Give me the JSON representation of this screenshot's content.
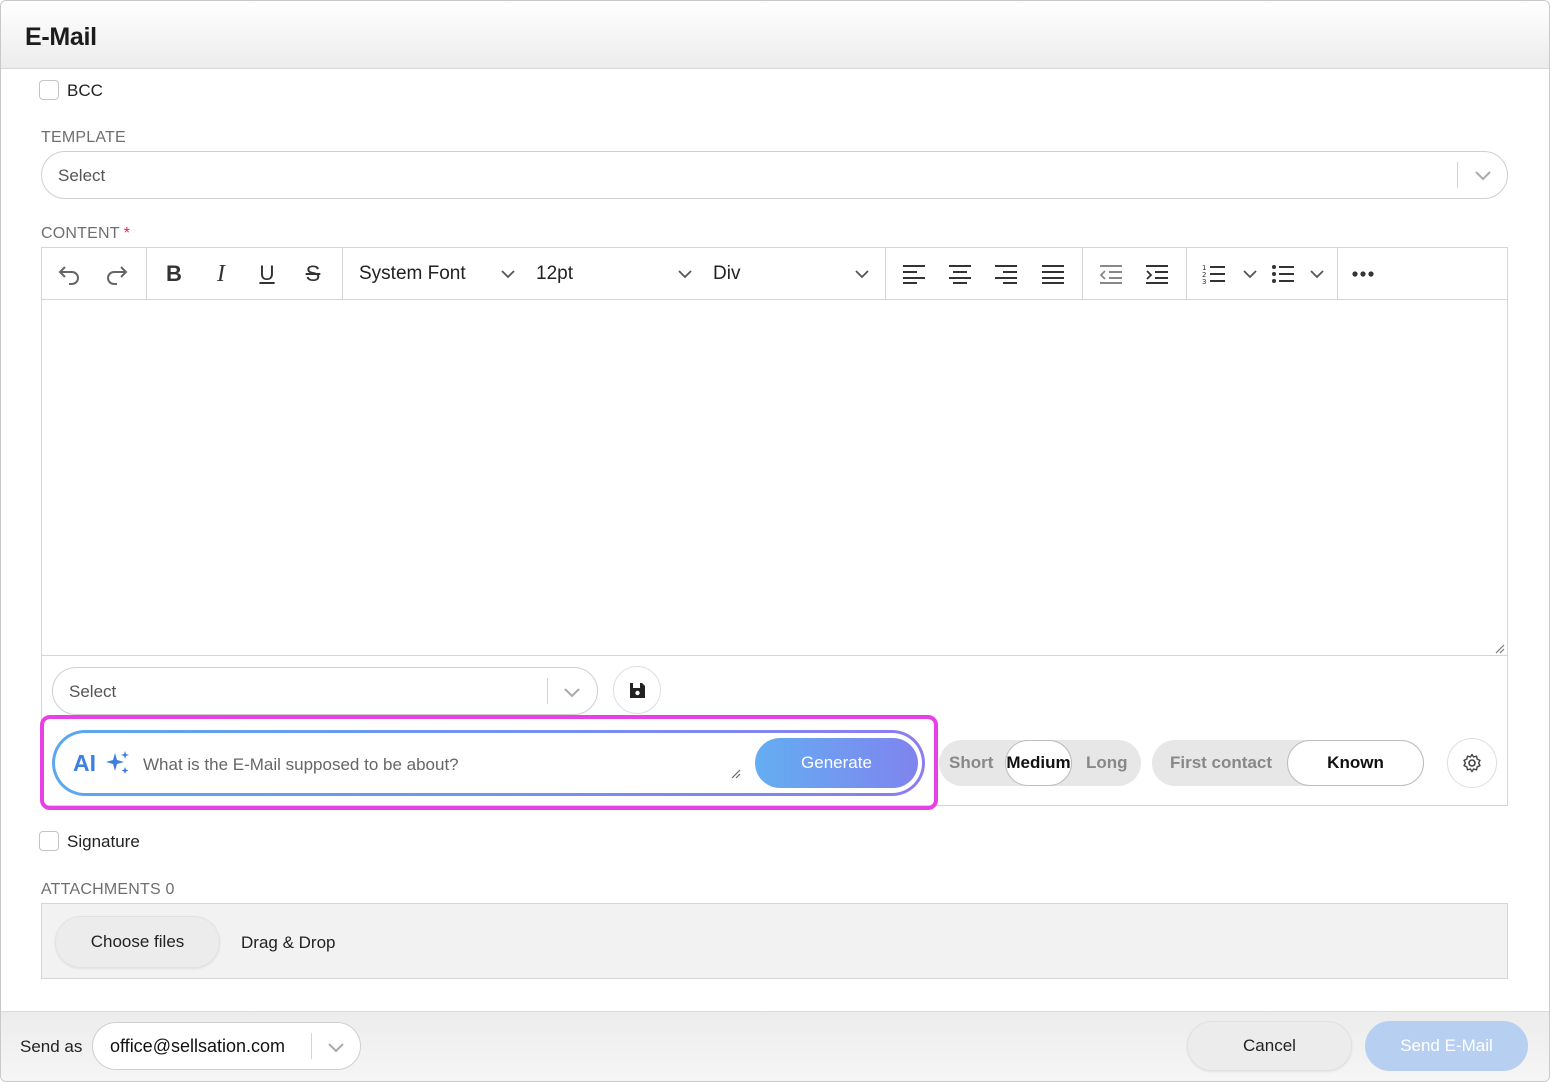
{
  "header": {
    "title": "E-Mail"
  },
  "bcc": {
    "label": "BCC",
    "checked": false
  },
  "template": {
    "label": "TEMPLATE",
    "value": "Select"
  },
  "content": {
    "label": "CONTENT",
    "required_mark": "*",
    "toolbar": {
      "font_family": "System Font",
      "font_size": "12pt",
      "block_format": "Div",
      "buttons": [
        "undo",
        "redo",
        "bold",
        "italic",
        "underline",
        "strikethrough",
        "align-left",
        "align-center",
        "align-right",
        "align-justify",
        "outdent",
        "indent",
        "numbered-list",
        "bullet-list",
        "more"
      ]
    },
    "body_text": ""
  },
  "snippet": {
    "value": "Select"
  },
  "ai": {
    "label": "AI",
    "placeholder": "What is the E-Mail supposed to be about?",
    "generate_label": "Generate",
    "length_options": [
      "Short",
      "Medium",
      "Long"
    ],
    "length_selected": "Medium",
    "relationship_options": [
      "First contact",
      "Known"
    ],
    "relationship_selected": "Known",
    "highlight_color": "#e640e6"
  },
  "signature": {
    "label": "Signature",
    "checked": false
  },
  "attachments": {
    "label": "ATTACHMENTS 0",
    "choose_label": "Choose files",
    "drop_label": "Drag & Drop"
  },
  "footer": {
    "send_as_label": "Send as",
    "send_as_value": "office@sellsation.com",
    "cancel_label": "Cancel",
    "send_label": "Send E-Mail",
    "send_color": "#b7cff0"
  }
}
